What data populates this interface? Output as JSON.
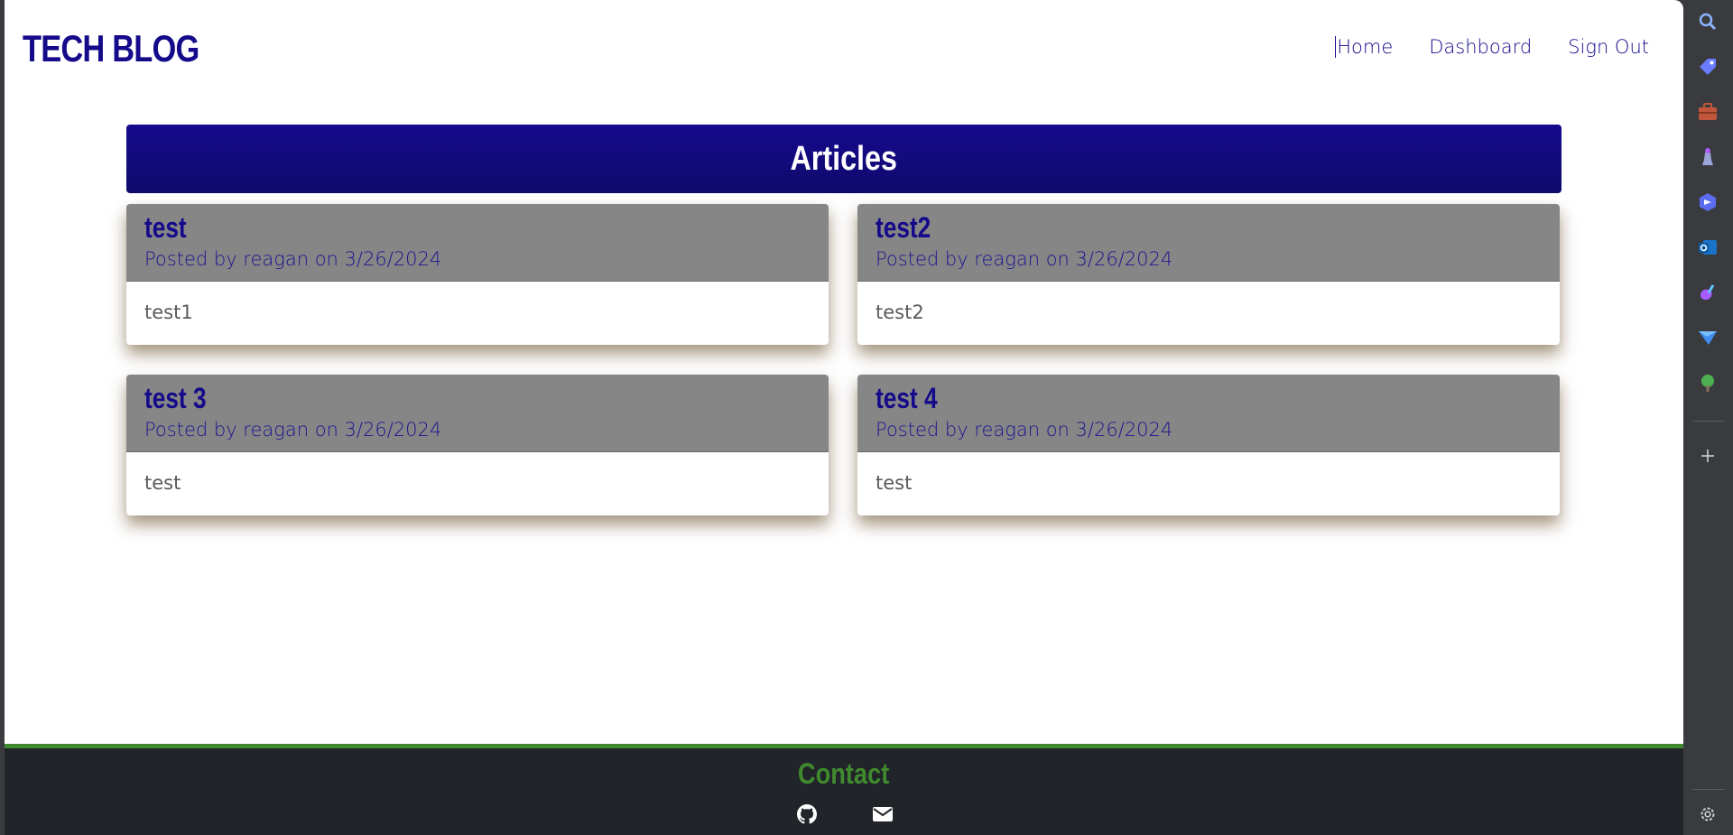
{
  "navbar": {
    "brand": "TECH BLOG",
    "links": [
      "Home",
      "Dashboard",
      "Sign Out"
    ]
  },
  "main": {
    "heading": "Articles",
    "articles": [
      {
        "title": "test",
        "meta": "Posted by reagan on 3/26/2024",
        "body": "test1"
      },
      {
        "title": "test2",
        "meta": "Posted by reagan on 3/26/2024",
        "body": "test2"
      },
      {
        "title": "test 3",
        "meta": "Posted by reagan on 3/26/2024",
        "body": "test"
      },
      {
        "title": "test 4",
        "meta": "Posted by reagan on 3/26/2024",
        "body": "test"
      }
    ]
  },
  "footer": {
    "title": "Contact",
    "icons": [
      "github-icon",
      "envelope-icon"
    ]
  },
  "side_rail": {
    "icons": [
      "search-icon",
      "tag-icon",
      "briefcase-icon",
      "chess-icon",
      "copilot-icon",
      "outlook-icon",
      "paint-icon",
      "send-icon",
      "tree-icon",
      "add-icon",
      "settings-icon"
    ]
  },
  "colors": {
    "brand": "#140a8a",
    "banner": "#16098f",
    "card_header": "#868686",
    "footer_bg": "#212529",
    "footer_accent": "#3f8a2e"
  }
}
